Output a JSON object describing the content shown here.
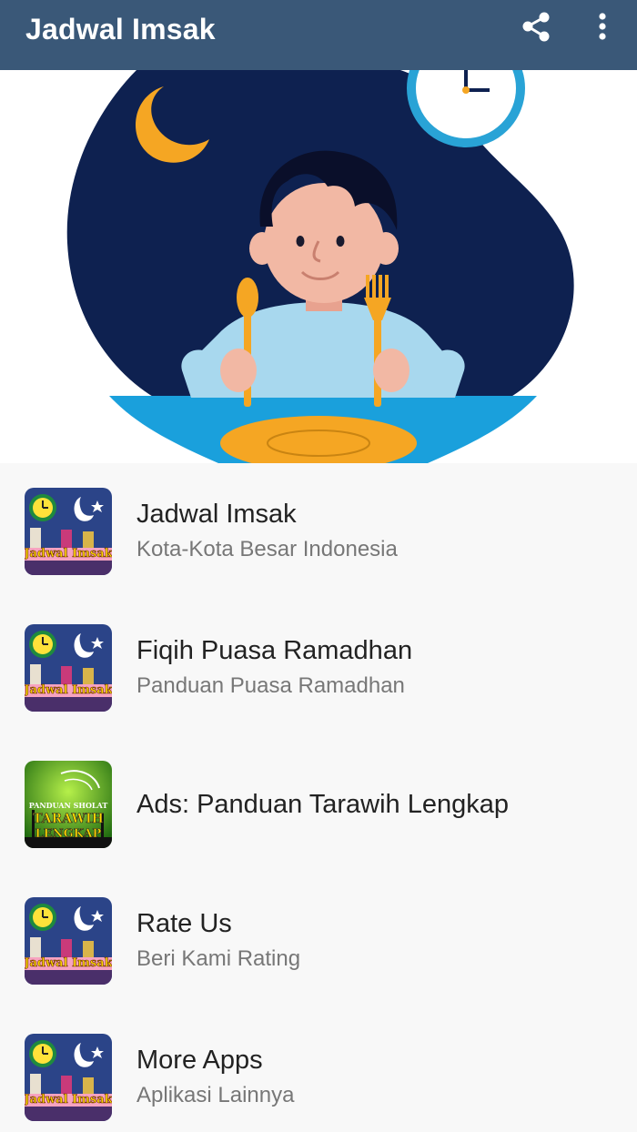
{
  "appbar": {
    "title": "Jadwal Imsak",
    "icons": [
      "share-icon",
      "more-vert-icon"
    ]
  },
  "hero": {
    "illustration": "child-eating-sahur-illustration"
  },
  "menu": {
    "items": [
      {
        "title": "Jadwal Imsak",
        "subtitle": "Kota-Kota Besar Indonesia",
        "icon": "jadwal-imsak-app-icon",
        "icon_text": "Jadwal Imsak"
      },
      {
        "title": "Fiqih Puasa Ramadhan",
        "subtitle": "Panduan Puasa Ramadhan",
        "icon": "jadwal-imsak-app-icon",
        "icon_text": "Jadwal Imsak"
      },
      {
        "title": "Ads: Panduan Tarawih Lengkap",
        "subtitle": "",
        "icon": "tarawih-app-icon",
        "icon_text_1": "PANDUAN SHOLAT",
        "icon_text_2": "TARAWIH",
        "icon_text_3": "LENGKAP"
      },
      {
        "title": "Rate Us",
        "subtitle": "Beri Kami Rating",
        "icon": "jadwal-imsak-app-icon",
        "icon_text": "Jadwal Imsak"
      },
      {
        "title": "More Apps",
        "subtitle": "Aplikasi Lainnya",
        "icon": "jadwal-imsak-app-icon",
        "icon_text": "Jadwal Imsak"
      }
    ]
  },
  "colors": {
    "appbar": "#3a5878",
    "list_background": "#f8f8f8",
    "blob": "#0e2150",
    "moon": "#f5a623",
    "clock": "#29a3d6"
  }
}
